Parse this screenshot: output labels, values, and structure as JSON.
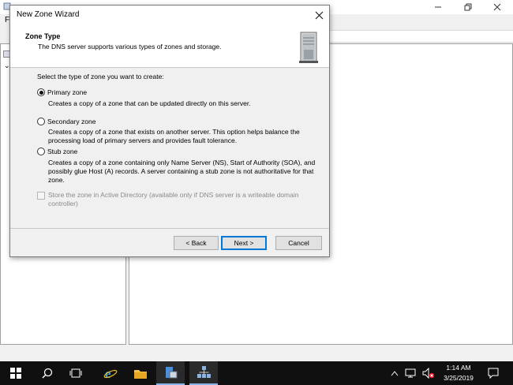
{
  "background_window": {
    "menu_initial": "F"
  },
  "dialog": {
    "title": "New Zone Wizard",
    "header_title": "Zone Type",
    "header_subtitle": "The DNS server supports various types of zones and storage.",
    "prompt": "Select the type of zone you want to create:",
    "options": [
      {
        "label": "Primary zone",
        "selected": true,
        "description": "Creates a copy of a zone that can be updated directly on this server."
      },
      {
        "label": "Secondary zone",
        "selected": false,
        "description": "Creates a copy of a zone that exists on another server. This option helps balance the processing load of primary servers and provides fault tolerance."
      },
      {
        "label": "Stub zone",
        "selected": false,
        "description": "Creates a copy of a zone containing only Name Server (NS), Start of Authority (SOA), and possibly glue Host (A) records. A server containing a stub zone is not authoritative for that zone."
      }
    ],
    "ad_checkbox": {
      "label": "Store the zone in Active Directory (available only if DNS server is a writeable domain controller)",
      "checked": false,
      "enabled": false
    },
    "buttons": {
      "back": "< Back",
      "next": "Next >",
      "cancel": "Cancel"
    }
  },
  "taskbar": {
    "icons": [
      "start-icon",
      "search-icon",
      "task-view-icon",
      "internet-explorer-icon",
      "file-explorer-icon",
      "server-manager-icon",
      "dns-manager-icon"
    ],
    "time": "1:14 AM",
    "date": "3/25/2019"
  },
  "colors": {
    "accent": "#0078d7",
    "taskbar": "#101010"
  }
}
